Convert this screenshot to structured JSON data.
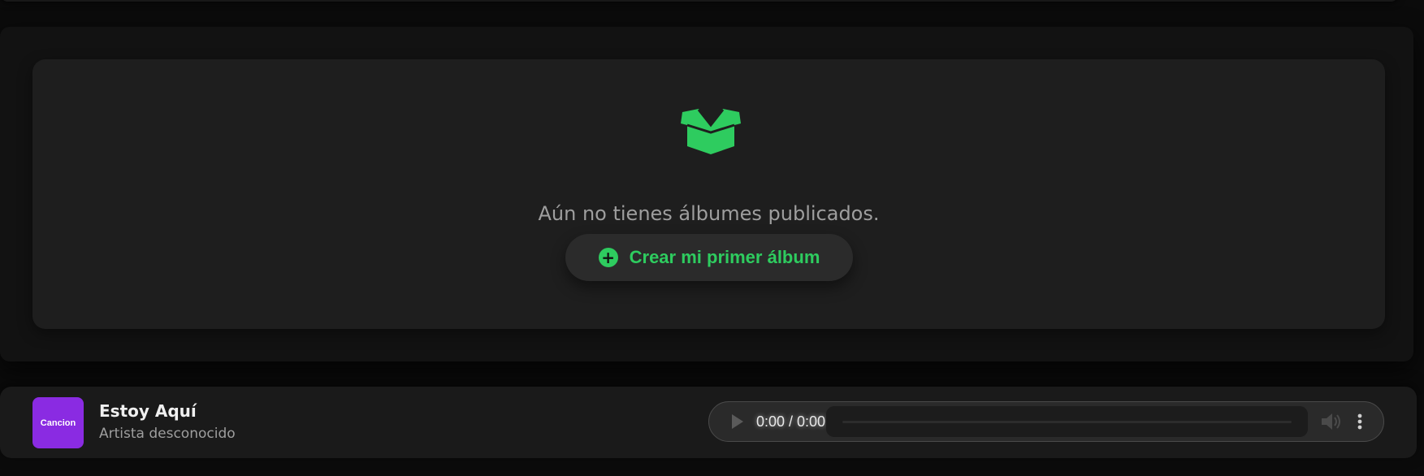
{
  "albums": {
    "empty_message": "Aún no tienes álbumes publicados.",
    "empty_icon": "open-box-icon",
    "create_button_label": "Crear mi primer álbum",
    "create_button_icon": "plus-circle-icon",
    "accent_color": "#2ecc5f"
  },
  "player": {
    "cover_label": "Cancion",
    "cover_color": "#8a2be2",
    "track_title": "Estoy Aquí",
    "track_artist": "Artista desconocido",
    "time_display": "0:00 / 0:00",
    "progress": 0,
    "icons": [
      "play-icon",
      "volume-icon",
      "more-options-icon"
    ]
  }
}
